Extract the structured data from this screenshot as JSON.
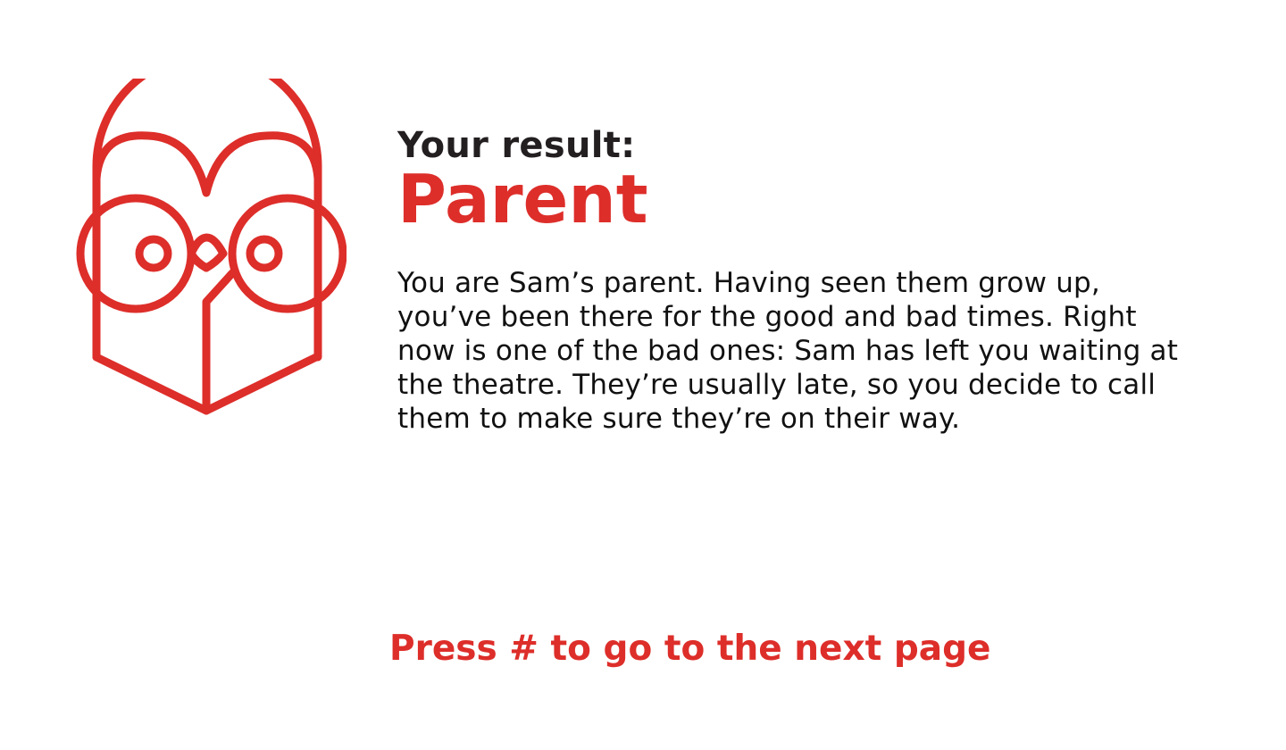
{
  "colors": {
    "accent": "#dd2e2a",
    "heading": "#231f20",
    "body_text": "#111111",
    "background": "#ffffff"
  },
  "logo": {
    "icon": "owl-logo-icon"
  },
  "result": {
    "label": "Your result:",
    "name": "Parent"
  },
  "description": {
    "lines": [
      "You are Sam’s parent. Having seen them grow up,",
      "you’ve been there for the good and bad times. Right",
      "now is one of the bad ones: Sam has left you waiting at",
      "the theatre. They’re usually late, so you decide to call",
      "them to make sure they’re on their way."
    ]
  },
  "footer": {
    "prompt": "Press # to go to the next page"
  }
}
